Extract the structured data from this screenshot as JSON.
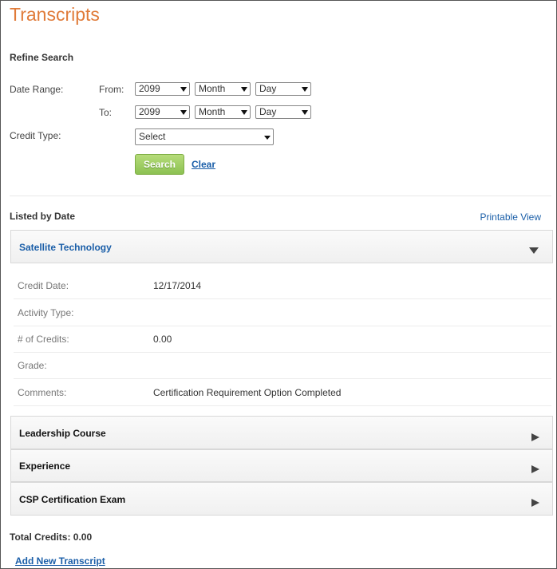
{
  "page": {
    "title": "Transcripts"
  },
  "refine": {
    "heading": "Refine Search",
    "date_range_label": "Date Range:",
    "from_label": "From:",
    "to_label": "To:",
    "from": {
      "year": "2099",
      "month": "Month",
      "day": "Day"
    },
    "to": {
      "year": "2099",
      "month": "Month",
      "day": "Day"
    },
    "credit_type_label": "Credit Type:",
    "credit_type_value": "Select",
    "search_label": "Search",
    "clear_label": "Clear"
  },
  "list": {
    "heading": "Listed by Date",
    "printable_view": "Printable View",
    "expanded": {
      "title": "Satellite Technology",
      "title_color": "#1a5ea8",
      "rows": [
        {
          "label": "Credit Date:",
          "value": "12/17/2014"
        },
        {
          "label": "Activity Type:",
          "value": ""
        },
        {
          "label": "# of Credits:",
          "value": "0.00"
        },
        {
          "label": "Grade:",
          "value": ""
        },
        {
          "label": "Comments:",
          "value": "Certification Requirement Option Completed"
        }
      ]
    },
    "collapsed": [
      {
        "title": "Leadership Course"
      },
      {
        "title": "Experience"
      },
      {
        "title": "CSP Certification Exam"
      }
    ]
  },
  "footer": {
    "total_credits": "Total Credits: 0.00",
    "add_new": "Add New Transcript"
  },
  "colors": {
    "title": "#e07b39",
    "link": "#1a5ea8",
    "search_button": "#8cc152"
  },
  "icons": {
    "expanded": "triangle-down-icon",
    "collapsed": "triangle-right-icon",
    "select": "chevron-down-icon"
  }
}
